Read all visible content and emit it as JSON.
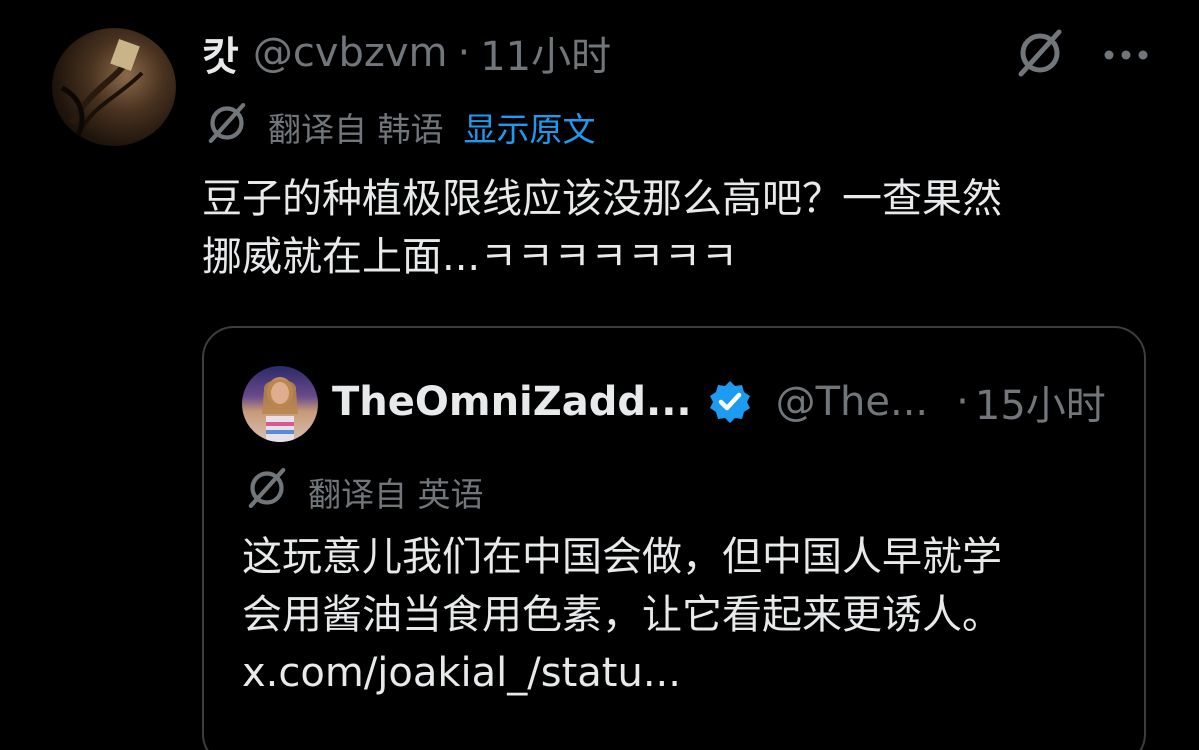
{
  "post": {
    "author_name": "캇",
    "handle": "@cvbzvm",
    "separator": "·",
    "time": "11小时",
    "translated_from": "翻译自 韩语",
    "show_original": "显示原文",
    "text_line1": "豆子的种植极限线应该没那么高吧？一查果然",
    "text_line2": "挪威就在上面...ㅋㅋㅋㅋㅋㅋㅋ"
  },
  "icons": {
    "top_right": [
      "grok-icon",
      "more-options-icon"
    ],
    "translate": "translate-icon",
    "verified": "verified-badge-icon"
  },
  "quote": {
    "author_name": "TheOmniZadd...",
    "handle": "@The...",
    "separator": "·",
    "time": "15小时",
    "translated_from": "翻译自 英语",
    "text_line1": "这玩意儿我们在中国会做，但中国人早就学",
    "text_line2": "会用酱油当食用色素，让它看起来更诱人。",
    "link": "x.com/joakial_/statu..."
  },
  "colors": {
    "background": "#000000",
    "text": "#e7e9ea",
    "muted": "#71767b",
    "accent": "#1d9bf0",
    "border": "#3a3d41"
  }
}
